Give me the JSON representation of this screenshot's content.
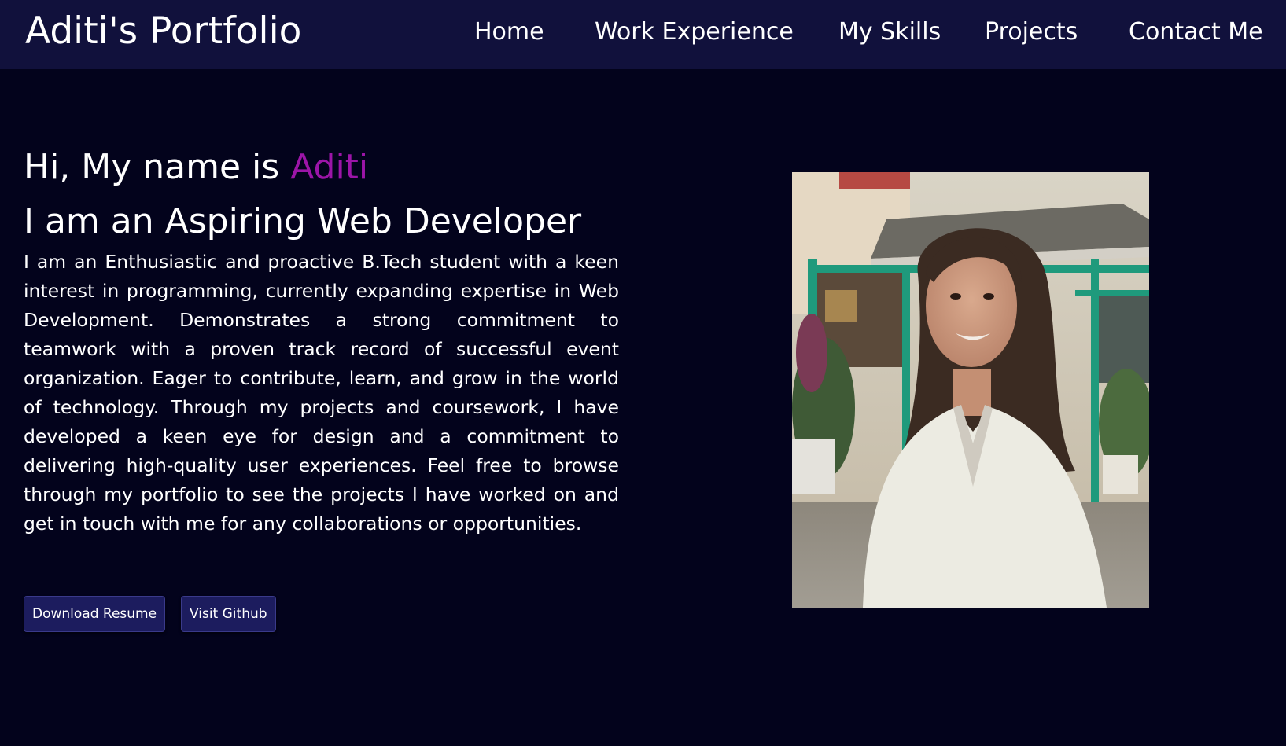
{
  "header": {
    "brand": "Aditi's Portfolio",
    "nav": [
      {
        "label": "Home"
      },
      {
        "label": "Work Experience"
      },
      {
        "label": "My Skills"
      },
      {
        "label": "Projects"
      },
      {
        "label": "Contact Me"
      }
    ]
  },
  "hero": {
    "greeting_prefix": "Hi, My name is ",
    "name": "Aditi",
    "tagline": "I am an Aspiring Web Developer",
    "bio": "I am an Enthusiastic and proactive B.Tech student with a keen interest in programming, currently expanding expertise in Web Development. Demonstrates a strong commitment to teamwork with a proven track record of successful event organization. Eager to contribute, learn, and grow in the world of technology. Through my projects and coursework, I have developed a keen eye for design and a commitment to delivering high-quality user experiences. Feel free to browse through my portfolio to see the projects I have worked on and get in touch with me for any collaborations or opportunities.",
    "buttons": {
      "download_resume": "Download Resume",
      "visit_github": "Visit Github"
    }
  },
  "colors": {
    "background": "#03031c",
    "navbar": "#11113c",
    "accent": "#9c15a8",
    "button": "#1c1c5e"
  },
  "icons": {
    "profile_photo": "portrait-photo"
  }
}
